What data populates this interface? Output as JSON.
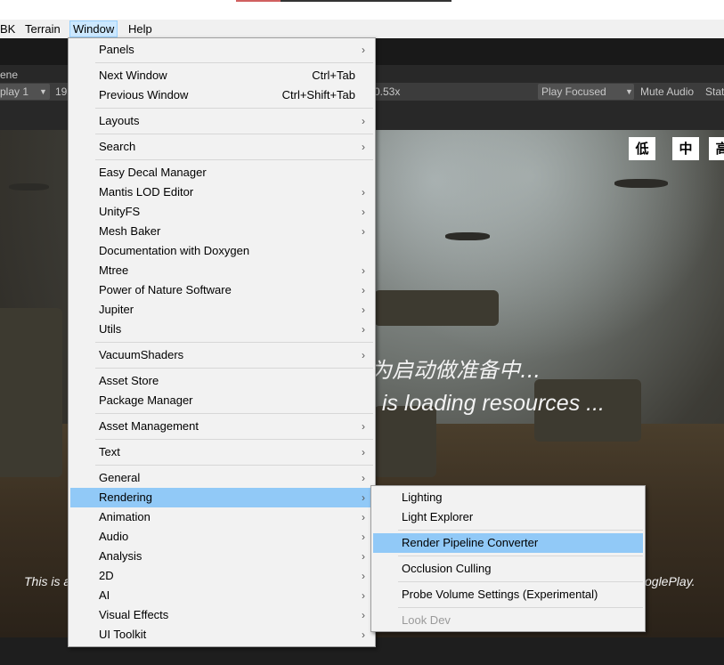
{
  "menubar": {
    "items": [
      "BK",
      "Terrain",
      "Window",
      "Help"
    ]
  },
  "editor": {
    "scene_tab": "ene",
    "display": "play 1",
    "resolution": "19",
    "scale": "0.53x",
    "play_focused": "Play Focused",
    "mute_audio": "Mute Audio",
    "stats": "Stat"
  },
  "game": {
    "quality": [
      "低",
      "中",
      "高"
    ],
    "loading_cn": "为启动做准备中...",
    "loading_en": "n is loading resources ...",
    "footer_left": "This is a",
    "footer_right": "oglePlay."
  },
  "window_menu": {
    "items": [
      {
        "label": "Panels",
        "submenu": true
      },
      {
        "label": "Next Window",
        "shortcut": "Ctrl+Tab"
      },
      {
        "label": "Previous Window",
        "shortcut": "Ctrl+Shift+Tab"
      },
      {
        "label": "Layouts",
        "submenu": true
      },
      {
        "label": "Search",
        "submenu": true
      },
      {
        "label": "Easy Decal Manager"
      },
      {
        "label": "Mantis LOD Editor",
        "submenu": true
      },
      {
        "label": "UnityFS",
        "submenu": true
      },
      {
        "label": "Mesh Baker",
        "submenu": true
      },
      {
        "label": "Documentation with Doxygen"
      },
      {
        "label": "Mtree",
        "submenu": true
      },
      {
        "label": "Power of Nature Software",
        "submenu": true
      },
      {
        "label": "Jupiter",
        "submenu": true
      },
      {
        "label": "Utils",
        "submenu": true
      },
      {
        "label": "VacuumShaders",
        "submenu": true
      },
      {
        "label": "Asset Store"
      },
      {
        "label": "Package Manager"
      },
      {
        "label": "Asset Management",
        "submenu": true
      },
      {
        "label": "Text",
        "submenu": true
      },
      {
        "label": "General",
        "submenu": true
      },
      {
        "label": "Rendering",
        "submenu": true
      },
      {
        "label": "Animation",
        "submenu": true
      },
      {
        "label": "Audio",
        "submenu": true
      },
      {
        "label": "Analysis",
        "submenu": true
      },
      {
        "label": "2D",
        "submenu": true
      },
      {
        "label": "AI",
        "submenu": true
      },
      {
        "label": "Visual Effects",
        "submenu": true
      },
      {
        "label": "UI Toolkit",
        "submenu": true
      }
    ]
  },
  "rendering_menu": {
    "items": [
      {
        "label": "Lighting"
      },
      {
        "label": "Light Explorer"
      },
      {
        "label": "Render Pipeline Converter"
      },
      {
        "label": "Occlusion Culling"
      },
      {
        "label": "Probe Volume Settings (Experimental)"
      },
      {
        "label": "Look Dev"
      }
    ]
  },
  "colors": {
    "highlight": "#91c9f7",
    "menu_bg": "#f2f2f2",
    "active_menubar": "#cce8ff"
  }
}
